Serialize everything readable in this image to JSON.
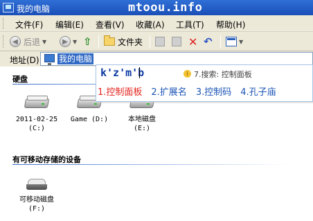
{
  "window": {
    "title": "我的电脑",
    "watermark": "mtoou.info"
  },
  "menu": [
    "文件(F)",
    "编辑(E)",
    "查看(V)",
    "收藏(A)",
    "工具(T)",
    "帮助(H)"
  ],
  "toolbar": {
    "back_label": "后退",
    "folders_label": "文件夹",
    "icons": [
      "back-icon",
      "forward-icon",
      "up-icon",
      "folders-icon",
      "move-to-icon",
      "copy-to-icon",
      "delete-icon",
      "undo-icon",
      "views-icon"
    ]
  },
  "address": {
    "label": "地址(D)",
    "value": "我的电脑"
  },
  "sections": {
    "hard_disks": "硬盘",
    "removable": "有可移动存储的设备"
  },
  "drives": [
    {
      "label": "2011-02-25\n(C:)"
    },
    {
      "label": "Game (D:)"
    },
    {
      "label": "本地磁盘\n(E:)"
    }
  ],
  "removable_drives": [
    {
      "label": "可移动磁盘\n(F:)"
    }
  ],
  "ime": {
    "composition": "k'z'm'b",
    "hint": "7.搜索: 控制面板",
    "candidates": [
      "1.控制面板",
      "2.扩展名",
      "3.控制码",
      "4.孔子庙"
    ],
    "selected_index": 0,
    "colors": {
      "selected": "#e3231d",
      "normal": "#1a54b5"
    }
  }
}
